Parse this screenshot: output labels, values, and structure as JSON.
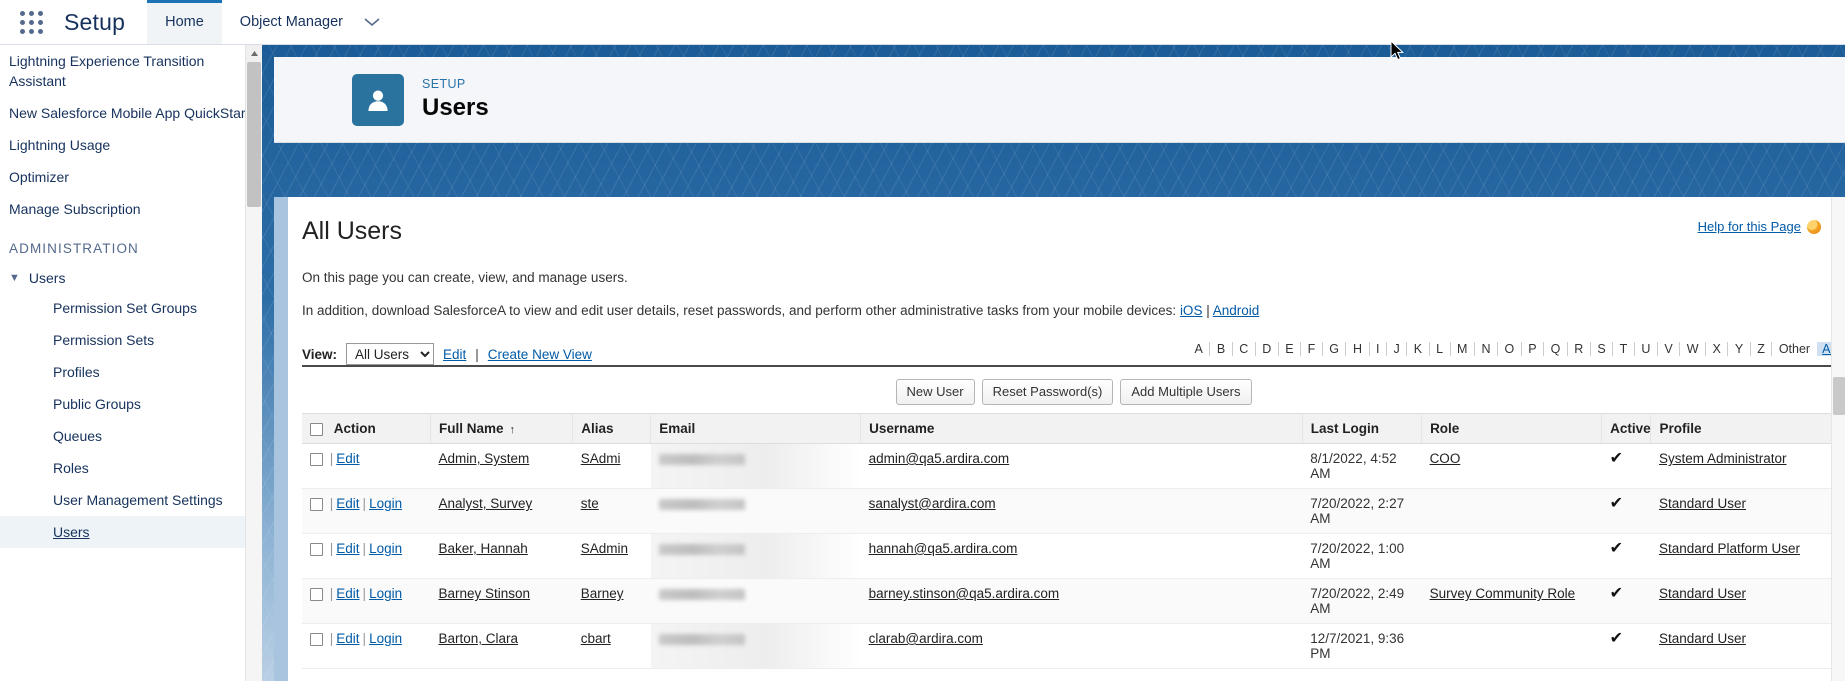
{
  "global_header": {
    "app_launcher_icon": "app-launcher-waffle-icon",
    "product": "Setup",
    "tabs": [
      {
        "label": "Home",
        "active": true
      },
      {
        "label": "Object Manager",
        "active": false
      }
    ],
    "caret_icon": "chevron-down-icon"
  },
  "sidebar": {
    "top_items": [
      {
        "label": "Lightning Experience Transition Assistant"
      },
      {
        "label": "New Salesforce Mobile App QuickStart"
      },
      {
        "label": "Lightning Usage"
      },
      {
        "label": "Optimizer"
      },
      {
        "label": "Manage Subscription"
      }
    ],
    "section_label": "ADMINISTRATION",
    "parent": {
      "label": "Users",
      "twisty_icon": "chevron-down-icon",
      "expanded": true
    },
    "children": [
      {
        "label": "Permission Set Groups",
        "selected": false
      },
      {
        "label": "Permission Sets",
        "selected": false
      },
      {
        "label": "Profiles",
        "selected": false
      },
      {
        "label": "Public Groups",
        "selected": false
      },
      {
        "label": "Queues",
        "selected": false
      },
      {
        "label": "Roles",
        "selected": false
      },
      {
        "label": "User Management Settings",
        "selected": false
      },
      {
        "label": "Users",
        "selected": true
      }
    ],
    "scroll_up_icon": "triangle-up-icon"
  },
  "setup_header": {
    "icon": "user-avatar-icon",
    "eyebrow": "SETUP",
    "title": "Users",
    "icon_color": "#2a739e"
  },
  "page": {
    "heading": "All Users",
    "help_link": "Help for this Page",
    "help_icon": "help-orb-icon",
    "intro_1": "On this page you can create, view, and manage users.",
    "intro_2_pre": "In addition, download SalesforceA to view and edit user details, reset passwords, and perform other administrative tasks from your mobile devices: ",
    "intro_2_link_ios": "iOS",
    "intro_2_sep": " | ",
    "intro_2_link_android": "Android"
  },
  "view_bar": {
    "label": "View:",
    "selected": "All Users",
    "options": [
      "All Users"
    ],
    "edit_link": "Edit",
    "separator": "|",
    "create_link": "Create New View"
  },
  "alpha_filter": {
    "letters": [
      "A",
      "B",
      "C",
      "D",
      "E",
      "F",
      "G",
      "H",
      "I",
      "J",
      "K",
      "L",
      "M",
      "N",
      "O",
      "P",
      "Q",
      "R",
      "S",
      "T",
      "U",
      "V",
      "W",
      "X",
      "Y",
      "Z"
    ],
    "other": "Other",
    "all": "All"
  },
  "action_buttons": [
    {
      "label": "New User"
    },
    {
      "label": "Reset Password(s)"
    },
    {
      "label": "Add Multiple Users"
    }
  ],
  "table": {
    "select_all_checkbox": "select-all",
    "columns": [
      {
        "key": "action",
        "label": "Action"
      },
      {
        "key": "name",
        "label": "Full Name",
        "sorted": "asc",
        "sort_icon": "↑"
      },
      {
        "key": "alias",
        "label": "Alias"
      },
      {
        "key": "email",
        "label": "Email"
      },
      {
        "key": "username",
        "label": "Username"
      },
      {
        "key": "login",
        "label": "Last Login"
      },
      {
        "key": "role",
        "label": "Role"
      },
      {
        "key": "active",
        "label": "Active"
      },
      {
        "key": "profile",
        "label": "Profile"
      }
    ],
    "rows": [
      {
        "actions": [
          "Edit"
        ],
        "name": "Admin, System",
        "alias": "SAdmi",
        "email_redacted": true,
        "username": "admin@qa5.ardira.com",
        "last_login": "8/1/2022, 4:52 AM",
        "role": "COO",
        "active": "✔",
        "profile": "System Administrator"
      },
      {
        "actions": [
          "Edit",
          "Login"
        ],
        "name": "Analyst, Survey",
        "alias": "ste",
        "email_redacted": true,
        "username": "sanalyst@ardira.com",
        "last_login": "7/20/2022, 2:27 AM",
        "role": "",
        "active": "✔",
        "profile": "Standard User"
      },
      {
        "actions": [
          "Edit",
          "Login"
        ],
        "name": "Baker, Hannah",
        "alias": "SAdmin",
        "email_redacted": true,
        "username": "hannah@qa5.ardira.com",
        "last_login": "7/20/2022, 1:00 AM",
        "role": "",
        "active": "✔",
        "profile": "Standard Platform User"
      },
      {
        "actions": [
          "Edit",
          "Login"
        ],
        "name": "Barney Stinson",
        "alias": "Barney",
        "email_redacted": true,
        "username": "barney.stinson@qa5.ardira.com",
        "last_login": "7/20/2022, 2:49 AM",
        "role": "Survey Community Role",
        "active": "✔",
        "profile": "Standard User"
      },
      {
        "actions": [
          "Edit",
          "Login"
        ],
        "name": "Barton, Clara",
        "alias": "cbart",
        "email_redacted": true,
        "username": "clarab@ardira.com",
        "last_login": "12/7/2021, 9:36 PM",
        "role": "",
        "active": "✔",
        "profile": "Standard User"
      }
    ]
  },
  "colors": {
    "brand_blue": "#1b72b5",
    "link": "#015ba7",
    "banner": "#1c5d99",
    "selected_nav": "#eef3f8"
  }
}
